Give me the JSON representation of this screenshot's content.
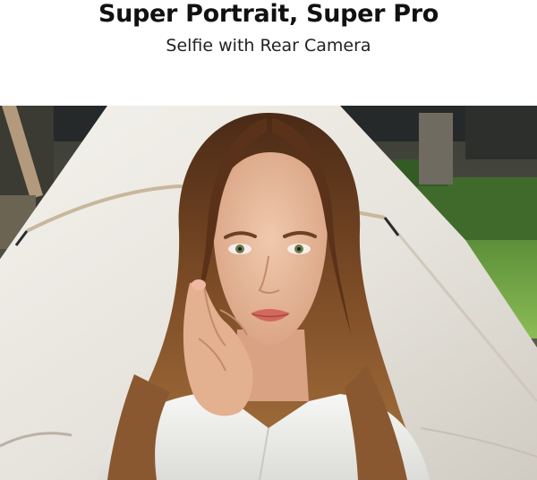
{
  "header": {
    "title": "Super Portrait, Super Pro",
    "subtitle": "Selfie with Rear Camera"
  },
  "photo": {
    "icon": "portrait-photo"
  }
}
